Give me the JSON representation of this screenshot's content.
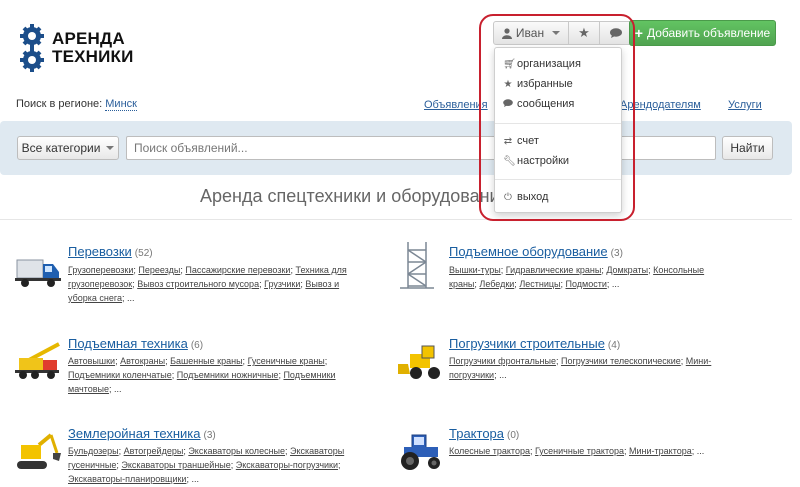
{
  "logo": {
    "line1": "АРЕНДА",
    "line2": "ТЕХНИКИ"
  },
  "user_menu": {
    "user_name": "Иван",
    "favorites_icon": "star-icon",
    "messages_icon": "chat-icon",
    "items": [
      {
        "label": "организация",
        "icon": "cart-icon"
      },
      {
        "label": "избранные",
        "icon": "star-icon"
      },
      {
        "label": "сообщения",
        "icon": "chat-icon"
      },
      {
        "label": "счет",
        "icon": "refresh-icon"
      },
      {
        "label": "настройки",
        "icon": "wrench-icon"
      },
      {
        "label": "выход",
        "icon": "power-icon"
      }
    ]
  },
  "add_button": {
    "label": "Добавить объявление"
  },
  "region": {
    "label": "Поиск в регионе:",
    "city": "Минск"
  },
  "nav": [
    "Объявления",
    "Арендодателям",
    "Услуги"
  ],
  "search": {
    "category_label": "Все категории",
    "placeholder": "Поиск объявлений...",
    "button": "Найти"
  },
  "page_title": "Аренда спецтехники и оборудования",
  "categories": [
    {
      "title": "Перевозки",
      "count": "(52)",
      "icon": "truck-icon",
      "lines": [
        [
          "Грузоперевозки",
          "Переезды",
          "Пассажирские перевозки",
          "Техника для"
        ],
        [
          "грузоперевозок",
          "Вывоз строительного мусора",
          "Грузчики",
          "Вывоз и"
        ],
        [
          "уборка снега",
          "..."
        ]
      ]
    },
    {
      "title": "Подъемное оборудование",
      "count": "(3)",
      "icon": "scaffold-icon",
      "lines": [
        [
          "Вышки-туры",
          "Гидравлические краны",
          "Домкраты",
          "Консольные"
        ],
        [
          "краны",
          "Лебедки",
          "Лестницы",
          "Подмости",
          "..."
        ]
      ]
    },
    {
      "title": "Подъемная техника",
      "count": "(6)",
      "icon": "crane-truck-icon",
      "lines": [
        [
          "Автовышки",
          "Автокраны",
          "Башенные краны",
          "Гусеничные краны"
        ],
        [
          "Подъемники коленчатые",
          "Подъемники ножничные",
          "Подъемники"
        ],
        [
          "мачтовые",
          "..."
        ]
      ]
    },
    {
      "title": "Погрузчики строительные",
      "count": "(4)",
      "icon": "loader-icon",
      "lines": [
        [
          "Погрузчики фронтальные",
          "Погрузчики телескопические",
          "Мини-"
        ],
        [
          "погрузчики",
          "..."
        ]
      ]
    },
    {
      "title": "Землеройная техника",
      "count": "(3)",
      "icon": "excavator-icon",
      "lines": [
        [
          "Бульдозеры",
          "Автогрейдеры",
          "Экскаваторы колесные",
          "Экскаваторы"
        ],
        [
          "гусеничные",
          "Экскаваторы траншейные",
          "Экскаваторы-погрузчики"
        ],
        [
          "Экскаваторы-планировщики",
          "..."
        ]
      ]
    },
    {
      "title": "Трактора",
      "count": "(0)",
      "icon": "tractor-icon",
      "lines": [
        [
          "Колесные трактора",
          "Гусеничные трактора",
          "Мини-трактора",
          "..."
        ]
      ]
    }
  ]
}
